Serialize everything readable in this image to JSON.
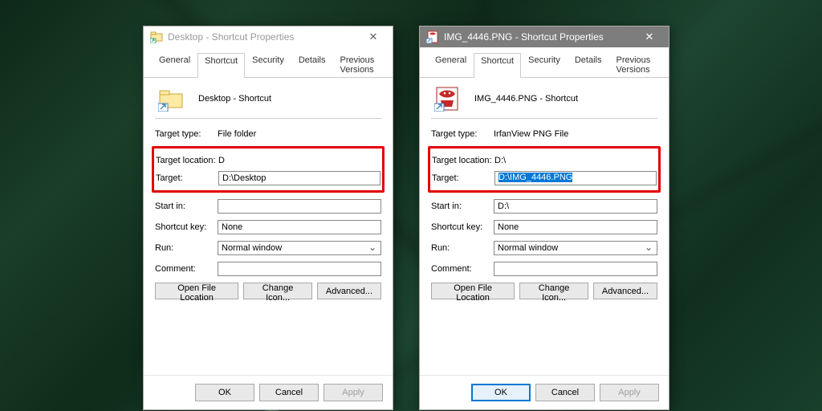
{
  "tabs": {
    "general": "General",
    "shortcut": "Shortcut",
    "security": "Security",
    "details": "Details",
    "previous": "Previous Versions"
  },
  "labels": {
    "target_type": "Target type:",
    "target_location": "Target location:",
    "target": "Target:",
    "start_in": "Start in:",
    "shortcut_key": "Shortcut key:",
    "run": "Run:",
    "comment": "Comment:"
  },
  "buttons": {
    "open_loc": "Open File Location",
    "change_icon": "Change Icon...",
    "advanced": "Advanced...",
    "ok": "OK",
    "cancel": "Cancel",
    "apply": "Apply"
  },
  "run_value": "Normal window",
  "shortcut_key_value": "None",
  "left": {
    "title": "Desktop - Shortcut Properties",
    "name": "Desktop - Shortcut",
    "target_type": "File folder",
    "target_location": "D:\\",
    "target_location_partial": "D",
    "target": "D:\\Desktop",
    "start_in": "",
    "active": false
  },
  "right": {
    "title": "IMG_4446.PNG - Shortcut Properties",
    "name": "IMG_4446.PNG - Shortcut",
    "target_type": "IrfanView PNG File",
    "target_location": "D:\\",
    "target": "D:\\IMG_4446.PNG",
    "start_in": "D:\\",
    "active": true
  }
}
